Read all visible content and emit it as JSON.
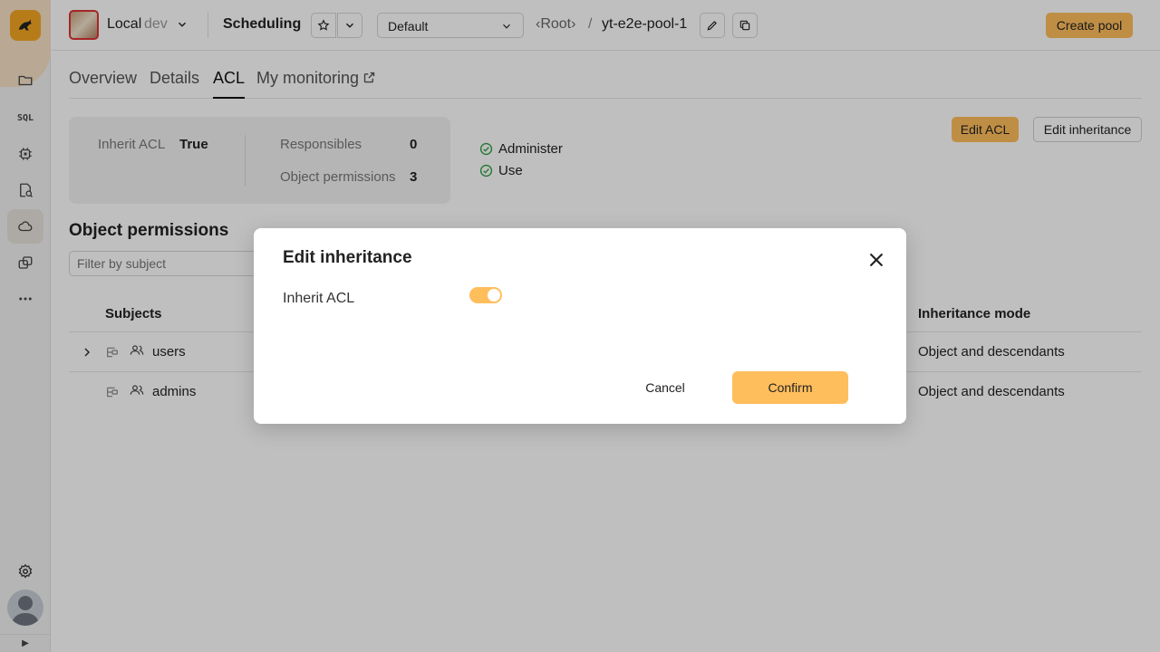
{
  "header": {
    "cluster_name": "Local",
    "cluster_env": "dev",
    "page_title": "Scheduling",
    "pool_tree": "Default",
    "breadcrumb_root": "‹Root›",
    "breadcrumb_sep": "/",
    "pool_name": "yt-e2e-pool-1",
    "create_pool_label": "Create pool"
  },
  "sidebar": {
    "sql_label": "SQL",
    "items": [
      "folder-icon",
      "sql-icon",
      "chip-icon",
      "query-icon",
      "cloud-icon",
      "scheduling-icon",
      "more-icon"
    ],
    "active_item": "cloud-icon"
  },
  "tabs": [
    {
      "label": "Overview"
    },
    {
      "label": "Details"
    },
    {
      "label": "ACL",
      "active": true
    },
    {
      "label": "My monitoring"
    }
  ],
  "summary": {
    "inherit_acl_label": "Inherit ACL",
    "inherit_acl_value": "True",
    "responsibles_label": "Responsibles",
    "responsibles_value": "0",
    "object_permissions_label": "Object permissions",
    "object_permissions_value": "3",
    "permissions": [
      "Administer",
      "Use"
    ]
  },
  "actions": {
    "edit_acl_label": "Edit ACL",
    "edit_inheritance_label": "Edit inheritance"
  },
  "object_permissions": {
    "title": "Object permissions",
    "filter_placeholder": "Filter by subject",
    "columns": {
      "subjects": "Subjects",
      "inheritance_mode": "Inheritance mode"
    },
    "rows": [
      {
        "subject": "users",
        "inheritance_mode": "Object and descendants",
        "expandable": true
      },
      {
        "subject": "admins",
        "inheritance_mode": "Object and descendants",
        "expandable": false
      }
    ]
  },
  "dialog": {
    "title": "Edit inheritance",
    "field_label": "Inherit ACL",
    "toggle_on": true,
    "cancel_label": "Cancel",
    "confirm_label": "Confirm"
  },
  "colors": {
    "accent": "#ffbe5c",
    "check": "#2f9e44"
  }
}
